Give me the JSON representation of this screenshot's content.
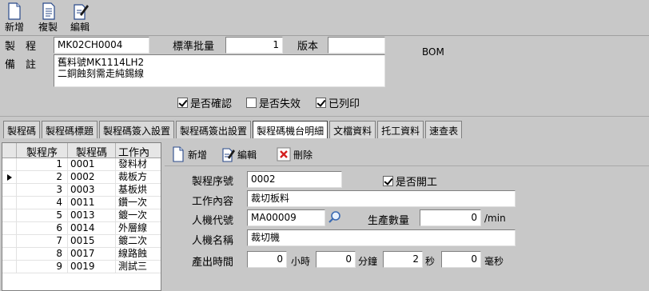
{
  "toolbar": {
    "new_label": "新增",
    "copy_label": "複製",
    "edit_label": "編輯"
  },
  "header": {
    "process_label": "製　程",
    "process_value": "MK02CH0004",
    "std_qty_label": "標準批量",
    "std_qty_value": "1",
    "version_label": "版本",
    "version_value": "",
    "bom_label": "BOM",
    "remark_label": "備　註",
    "remark_value": "舊料號MK1114LH2\n二銅蝕刻需走純錫線",
    "confirmed_label": "是否確認",
    "confirmed": true,
    "invalid_label": "是否失效",
    "invalid": false,
    "printed_label": "已列印",
    "printed": true
  },
  "tabs": [
    {
      "label": "製程碼",
      "active": false
    },
    {
      "label": "製程碼標題",
      "active": false
    },
    {
      "label": "製程碼簽入設置",
      "active": false
    },
    {
      "label": "製程碼簽出設置",
      "active": false
    },
    {
      "label": "製程碼機台明細",
      "active": true
    },
    {
      "label": "文檔資料",
      "active": false
    },
    {
      "label": "托工資料",
      "active": false
    },
    {
      "label": "速查表",
      "active": false
    }
  ],
  "grid": {
    "columns": [
      "製程序",
      "製程碼",
      "工作內"
    ],
    "selected_row": 1,
    "rows": [
      {
        "seq": "1",
        "code": "0001",
        "work": "發料材"
      },
      {
        "seq": "2",
        "code": "0002",
        "work": "裁板方"
      },
      {
        "seq": "3",
        "code": "0003",
        "work": "基板烘"
      },
      {
        "seq": "4",
        "code": "0011",
        "work": "鑽一次"
      },
      {
        "seq": "5",
        "code": "0013",
        "work": "鍍一次"
      },
      {
        "seq": "6",
        "code": "0014",
        "work": "外層線"
      },
      {
        "seq": "7",
        "code": "0015",
        "work": "鍍二次"
      },
      {
        "seq": "8",
        "code": "0017",
        "work": "線路蝕"
      },
      {
        "seq": "9",
        "code": "0019",
        "work": "測試三"
      }
    ]
  },
  "detail_toolbar": {
    "new_label": "新增",
    "edit_label": "編輯",
    "delete_label": "刪除"
  },
  "detail": {
    "seq_label": "製程序號",
    "seq_value": "0002",
    "open_label": "是否開工",
    "open": true,
    "work_label": "工作內容",
    "work_value": "裁切板料",
    "machine_label": "人機代號",
    "machine_value": "MA00009",
    "output_label": "生產數量",
    "output_value": "0",
    "output_unit": "/min",
    "machine_name_label": "人機名稱",
    "machine_name_value": "裁切機",
    "time_label": "產出時間",
    "hours_value": "0",
    "hours_unit": "小時",
    "minutes_value": "0",
    "minutes_unit": "分鐘",
    "seconds_value": "2",
    "seconds_unit": "秒",
    "ms_value": "0",
    "ms_unit": "毫秒"
  }
}
